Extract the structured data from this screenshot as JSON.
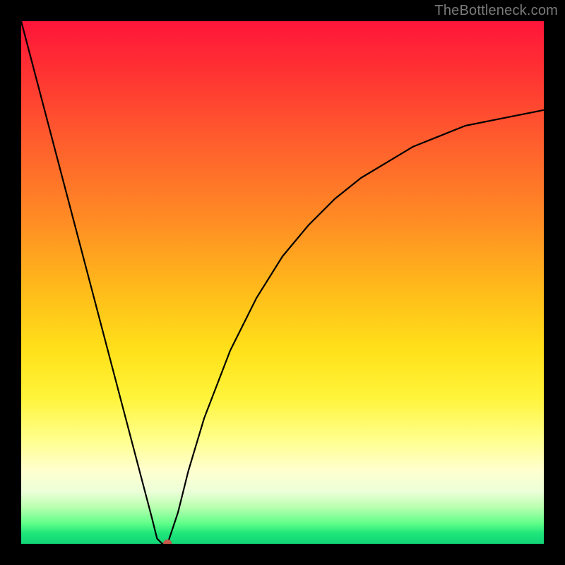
{
  "watermark": "TheBottleneck.com",
  "chart_data": {
    "type": "line",
    "title": "",
    "xlabel": "",
    "ylabel": "",
    "xlim": [
      0,
      100
    ],
    "ylim": [
      0,
      100
    ],
    "grid": false,
    "legend": false,
    "series": [
      {
        "name": "bottleneck-curve",
        "x": [
          0,
          5,
          10,
          15,
          20,
          25,
          26,
          27,
          28,
          30,
          32,
          35,
          40,
          45,
          50,
          55,
          60,
          65,
          70,
          75,
          80,
          85,
          90,
          95,
          100
        ],
        "y": [
          100,
          81,
          62,
          43,
          24,
          5,
          1,
          0,
          0,
          6,
          14,
          24,
          37,
          47,
          55,
          61,
          66,
          70,
          73,
          76,
          78,
          80,
          81,
          82,
          83
        ]
      }
    ],
    "minimum_marker": {
      "x": 28,
      "y": 0,
      "color": "#c75a4a"
    },
    "gradient": {
      "top_color": "#ff153a",
      "bottom_color": "#12d477"
    }
  }
}
